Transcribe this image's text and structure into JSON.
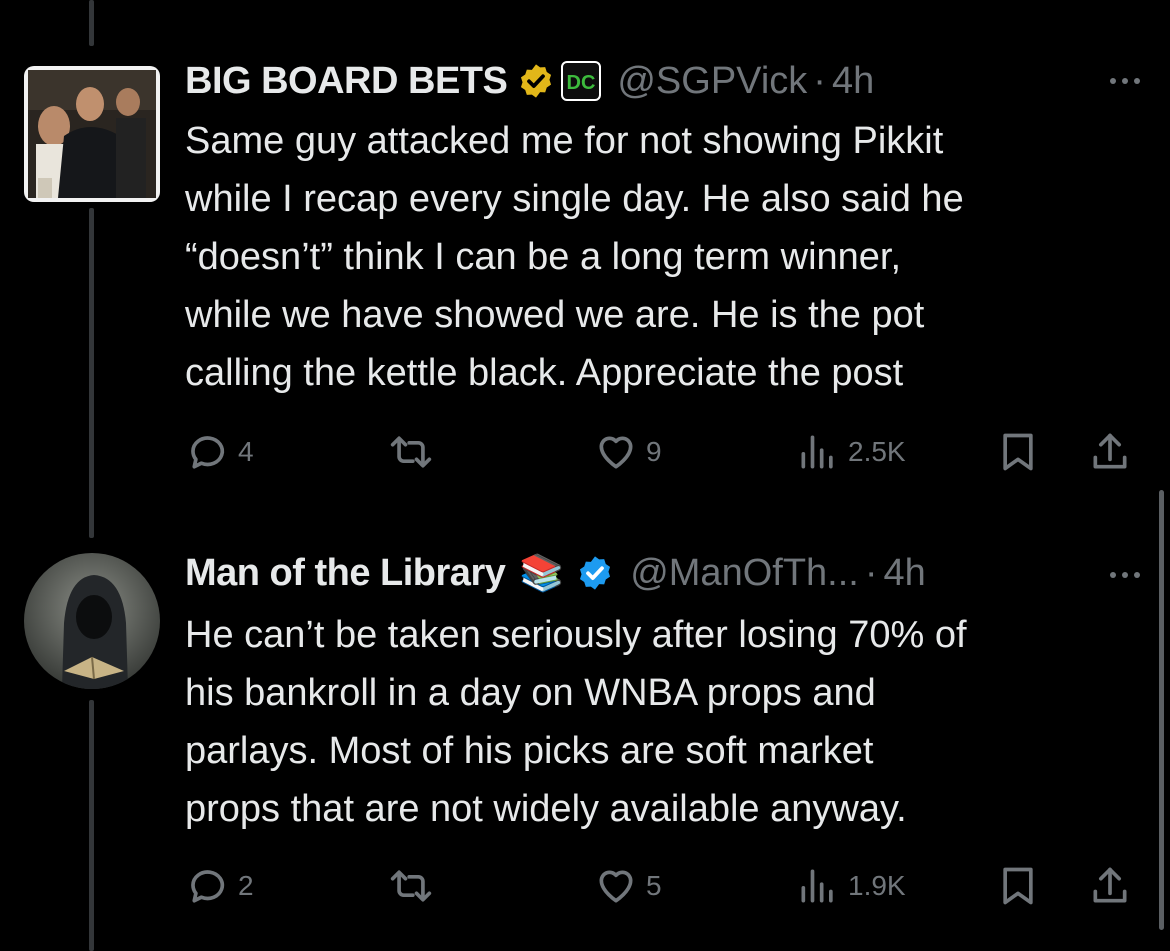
{
  "colors": {
    "background": "#000000",
    "text_primary": "#e7e9ea",
    "text_secondary": "#71767b",
    "verified_gold": "#e2b719",
    "verified_blue": "#1d9bf0"
  },
  "tweets": [
    {
      "display_name": "BIG BOARD BETS",
      "handle": "@SGPVick",
      "separator": "·",
      "time": "4h",
      "badge": "gold-verified-icon",
      "affiliate_label": "DC",
      "text": "Same guy attacked me for not showing Pikkit\nwhile I recap every single day. He also said he\n“doesn’t” think I can be a long term winner,\nwhile we have showed we are. He is the pot\ncalling the kettle black. Appreciate the post",
      "replies": "4",
      "reposts": "",
      "likes": "9",
      "views": "2.5K"
    },
    {
      "display_name": "Man of the Library",
      "emoji": "📚",
      "handle": "@ManOfTh...",
      "separator": "·",
      "time": "4h",
      "badge": "blue-verified-icon",
      "text": "He can’t be taken seriously after losing 70% of\nhis bankroll in a day on WNBA props and\nparlays. Most of his picks are soft market\nprops that are not widely available anyway.",
      "replies": "2",
      "reposts": "",
      "likes": "5",
      "views": "1.9K"
    }
  ]
}
